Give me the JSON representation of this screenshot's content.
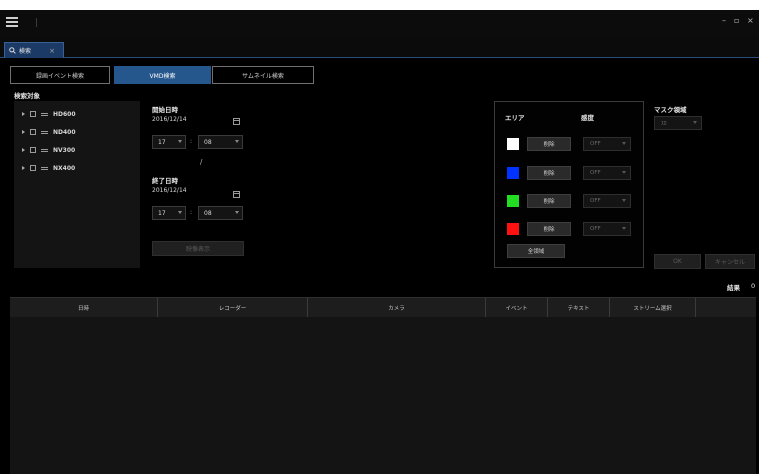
{
  "window": {
    "minimize_glyph": "–",
    "maximize_glyph": "▫",
    "close_glyph": "×"
  },
  "tab": {
    "label": "検索",
    "close_glyph": "×"
  },
  "modes": [
    {
      "label": "録画イベント検索",
      "active": false
    },
    {
      "label": "VMD検索",
      "active": true
    },
    {
      "label": "サムネイル検索",
      "active": false
    }
  ],
  "search_target": {
    "title": "検索対象",
    "recorders": [
      "HD600",
      "ND400",
      "NV300",
      "NX400"
    ]
  },
  "start": {
    "label": "開始日時",
    "date": "2016/12/14",
    "hour": "17",
    "minute": "08"
  },
  "range_separator": "/",
  "end": {
    "label": "終了日時",
    "date": "2016/12/14",
    "hour": "17",
    "minute": "08"
  },
  "time_separator": ":",
  "preview_button": "映像表示",
  "area": {
    "title": "エリア",
    "sensitivity_title": "感度",
    "rows": [
      {
        "color": "#ffffff",
        "button": "削除",
        "value": "OFF"
      },
      {
        "color": "#0033ff",
        "button": "削除",
        "value": "OFF"
      },
      {
        "color": "#22dd22",
        "button": "削除",
        "value": "OFF"
      },
      {
        "color": "#ff1111",
        "button": "削除",
        "value": "OFF"
      }
    ],
    "all_areas_button": "全領域"
  },
  "mask": {
    "title": "マスク領域",
    "value": "ｽﾛ"
  },
  "ok_button": "OK",
  "cancel_button": "キャンセル",
  "results": {
    "label": "結果",
    "count": "0"
  },
  "columns": [
    "日時",
    "レコーダー",
    "カメラ",
    "イベント",
    "テキスト",
    "ストリーム選択"
  ]
}
